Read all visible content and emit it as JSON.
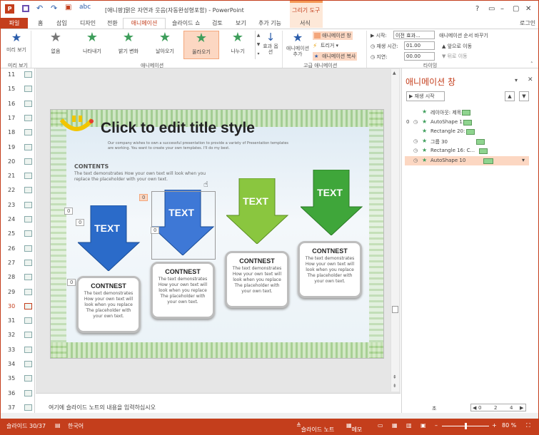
{
  "window": {
    "title": "[애니팡]맑은 자연과 웃음(자동완성형포함) - PowerPoint",
    "context_tool": "그리기 도구",
    "context_tab": "서식",
    "help": "?",
    "login": "로그인"
  },
  "tabs": [
    "파일",
    "홈",
    "삽입",
    "디자인",
    "전환",
    "애니메이션",
    "슬라이드 쇼",
    "검토",
    "보기",
    "추가 기능"
  ],
  "ribbon": {
    "preview": "미리 보기",
    "animations": [
      {
        "label": "없음",
        "color": "#777777"
      },
      {
        "label": "나타내기",
        "color": "#3e9e5b"
      },
      {
        "label": "밝기 변화",
        "color": "#3e9e5b"
      },
      {
        "label": "날아오기",
        "color": "#3e9e5b"
      },
      {
        "label": "올라오기",
        "color": "#3e9e5b"
      },
      {
        "label": "나누기",
        "color": "#3e9e5b"
      }
    ],
    "effect_options": "효과 옵션",
    "add_animation": "애니메이션 추가",
    "pane_btn": "애니메이션 창",
    "trigger": "트리거",
    "painter": "애니메이션 복사",
    "start_lbl": "시작:",
    "start_val": "이전 효과...",
    "duration_lbl": "재생 시간:",
    "duration_val": "01.00",
    "delay_lbl": "지연:",
    "delay_val": "00.00",
    "reorder": "애니메이션 순서 바꾸기",
    "move_earlier": "앞으로 이동",
    "move_later": "뒤로 이동",
    "groups": {
      "preview": "미리 보기",
      "animation": "애니메이션",
      "advanced": "고급 애니메이션",
      "timing": "타이밍"
    }
  },
  "thumbs": [
    "11",
    "15",
    "16",
    "17",
    "18",
    "19",
    "20",
    "21",
    "22",
    "23",
    "24",
    "25",
    "26",
    "27",
    "28",
    "29",
    "30",
    "31",
    "32",
    "33",
    "34",
    "35",
    "36",
    "37"
  ],
  "slide": {
    "title": "Click to edit title style",
    "subtitle": "Our company wishes to own a successful presentation to provide a variety of  Presentation templates are working. You want to create your own templates. I'll do my best.",
    "contents_h": "CONTENTS",
    "contents_b": "The text demonstrates How your own text will look when you replace the placeholder with your own text.",
    "arrow_text": "TEXT",
    "card_h": "CONTNEST",
    "card_b": "The text demonstrates How your own text will look when you replace The placeholder with your own text.",
    "tag0": "0"
  },
  "notes": "여기에 슬라이드 노트의 내용을 입력하십시오",
  "pane": {
    "title": "애니메이션 창",
    "play": "재생 시작",
    "up": "▲",
    "down": "▼",
    "items": [
      {
        "idx": "",
        "clock": "",
        "name": "레이아웃: 제목",
        "bar": [
          80,
          12
        ]
      },
      {
        "idx": "0",
        "clock": "◷",
        "name": "AutoShape 13",
        "bar": [
          82,
          12
        ]
      },
      {
        "idx": "",
        "clock": "",
        "name": "Rectangle 20: T...",
        "bar": [
          86,
          12
        ]
      },
      {
        "idx": "",
        "clock": "◷",
        "name": "그룹 30",
        "bar": [
          100,
          12
        ]
      },
      {
        "idx": "",
        "clock": "◷",
        "name": "Rectangle 16: C...",
        "bar": [
          104,
          12
        ]
      },
      {
        "idx": "",
        "clock": "◷",
        "name": "AutoShape 10",
        "bar": [
          110,
          14
        ]
      }
    ],
    "seconds": "초",
    "pager": [
      "0",
      "2",
      "4"
    ]
  },
  "status": {
    "slide": "슬라이드 30/37",
    "lang": "한국어",
    "notes": "슬라이드 노트",
    "memo": "메모",
    "zoom": "80 %"
  }
}
